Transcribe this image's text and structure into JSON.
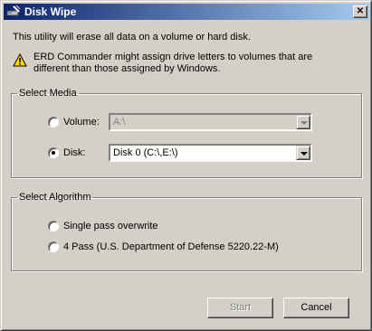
{
  "window": {
    "title": "Disk Wipe",
    "close_glyph": "✕"
  },
  "intro": "This utility will erase all data on a volume or hard disk.",
  "warning": {
    "line1": "ERD Commander might assign drive letters to volumes that are",
    "line2": "different than those assigned by Windows."
  },
  "media": {
    "legend": "Select Media",
    "volume": {
      "label": "Volume:",
      "selected": false,
      "value": "A:\\",
      "enabled": false
    },
    "disk": {
      "label": "Disk:",
      "selected": true,
      "value": "Disk 0 (C:\\,E:\\)",
      "enabled": true
    }
  },
  "algorithm": {
    "legend": "Select Algorithm",
    "options": [
      {
        "label": "Single pass overwrite",
        "selected": false
      },
      {
        "label": "4 Pass (U.S. Department of Defense 5220.22-M)",
        "selected": false
      }
    ]
  },
  "buttons": {
    "start": {
      "label": "Start",
      "enabled": false
    },
    "cancel": {
      "label": "Cancel",
      "enabled": true
    }
  },
  "icons": {
    "app": "disk-wipe-icon",
    "warning": "warning-icon"
  },
  "colors": {
    "face": "#d4d0c8",
    "title_start": "#0a246a",
    "title_end": "#a6caf0",
    "warning": "#ffd800"
  }
}
